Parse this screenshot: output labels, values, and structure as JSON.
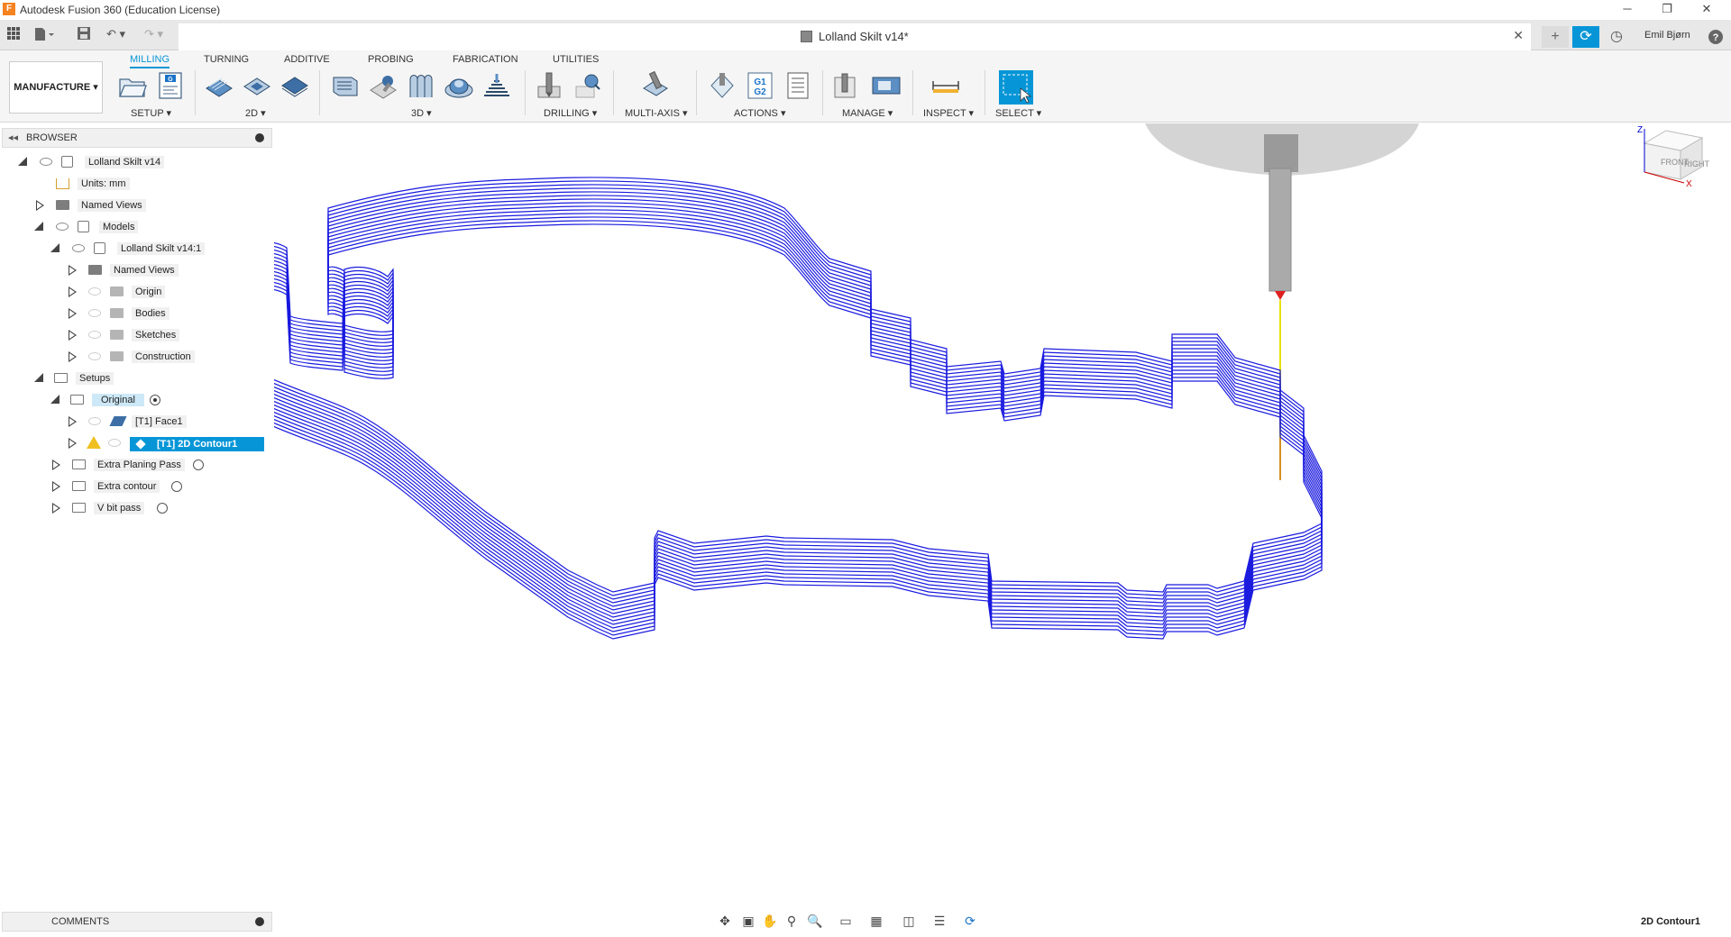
{
  "window": {
    "title": "Autodesk Fusion 360 (Education License)",
    "app_icon": "F"
  },
  "document": {
    "title": "Lolland Skilt v14*",
    "user": "Emil Bjørn"
  },
  "ribbon": {
    "workspace": "MANUFACTURE",
    "tabs": [
      {
        "label": "MILLING",
        "active": true
      },
      {
        "label": "TURNING",
        "active": false
      },
      {
        "label": "ADDITIVE",
        "active": false
      },
      {
        "label": "PROBING",
        "active": false
      },
      {
        "label": "FABRICATION",
        "active": false
      },
      {
        "label": "UTILITIES",
        "active": false
      }
    ],
    "groups": [
      {
        "label": "SETUP ▾"
      },
      {
        "label": "2D ▾"
      },
      {
        "label": "3D ▾"
      },
      {
        "label": "DRILLING ▾"
      },
      {
        "label": "MULTI-AXIS ▾"
      },
      {
        "label": "ACTIONS ▾"
      },
      {
        "label": "MANAGE ▾"
      },
      {
        "label": "INSPECT ▾"
      },
      {
        "label": "SELECT ▾"
      }
    ],
    "actions_code": "G1 G2"
  },
  "browser": {
    "title": "BROWSER",
    "items": [
      {
        "label": "Lolland Skilt v14"
      },
      {
        "label": "Units: mm"
      },
      {
        "label": "Named Views"
      },
      {
        "label": "Models"
      },
      {
        "label": "Lolland Skilt v14:1"
      },
      {
        "label": "Named Views"
      },
      {
        "label": "Origin"
      },
      {
        "label": "Bodies"
      },
      {
        "label": "Sketches"
      },
      {
        "label": "Construction"
      },
      {
        "label": "Setups"
      },
      {
        "label": "Original"
      },
      {
        "label": "[T1] Face1"
      },
      {
        "label": "[T1] 2D Contour1"
      },
      {
        "label": "Extra Planing Pass"
      },
      {
        "label": "Extra contour"
      },
      {
        "label": "V bit pass"
      }
    ]
  },
  "viewcube": {
    "front": "FRONT",
    "right": "RIGHT",
    "axis_z": "Z",
    "axis_x": "X"
  },
  "comments": {
    "title": "COMMENTS"
  },
  "status": {
    "selection": "2D Contour1"
  },
  "colors": {
    "accent": "#0696d7",
    "toolpath": "#1a1adf",
    "selected_bg": "#0696d7"
  }
}
